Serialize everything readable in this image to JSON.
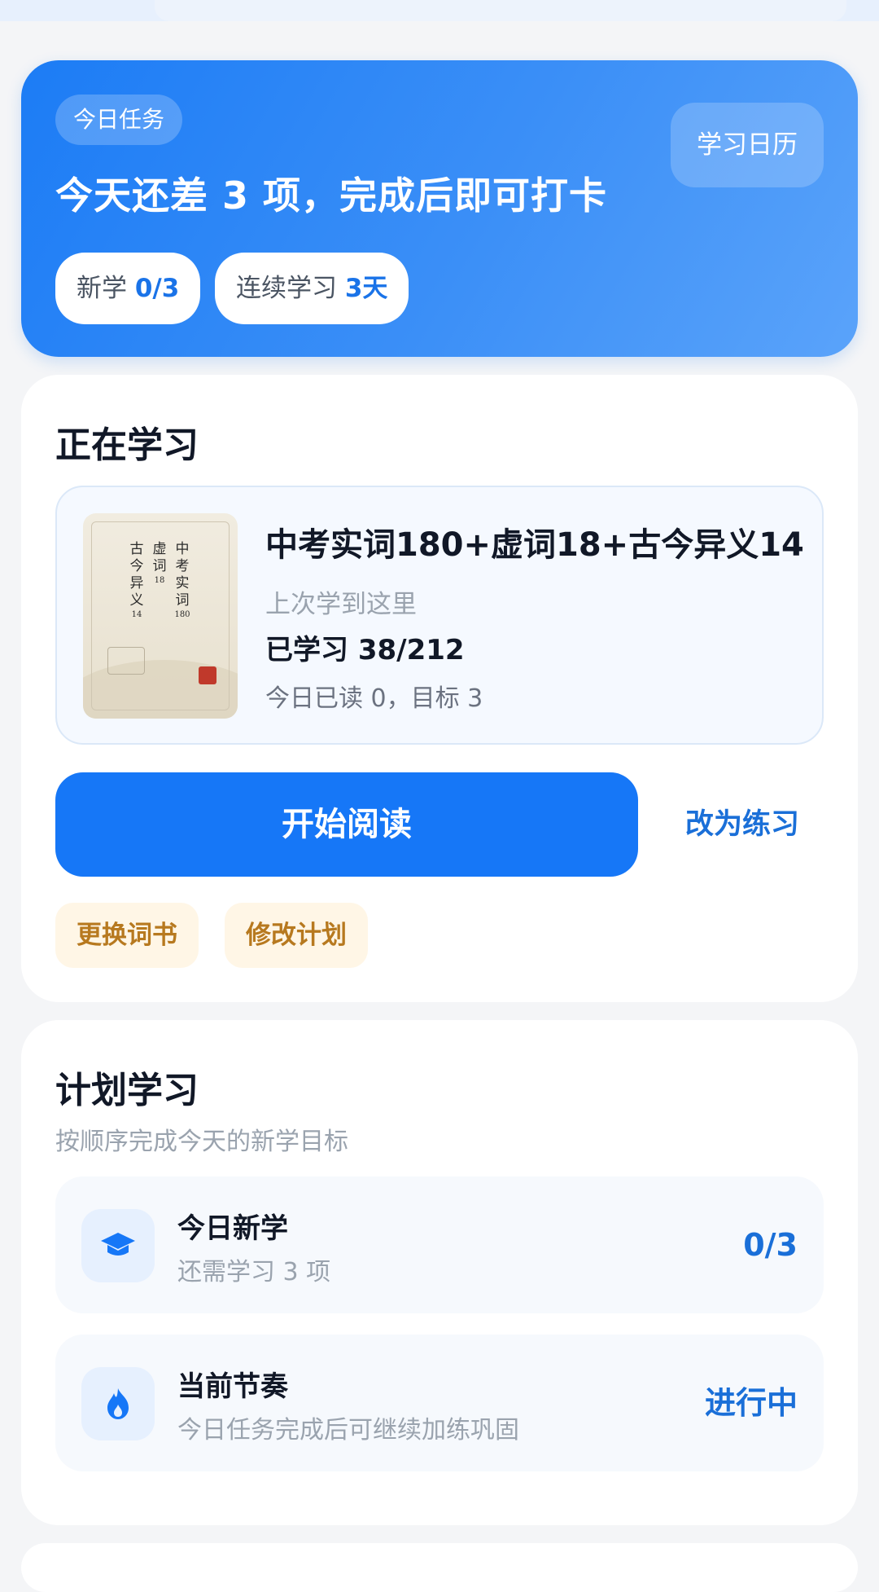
{
  "banner": {
    "chip": "今日任务",
    "title": "今天还差 3 项，完成后即可打卡",
    "calendar_button": "学习日历",
    "new_label": "新学",
    "new_value": "0/3",
    "streak_label": "连续学习",
    "streak_value": "3天"
  },
  "studying": {
    "title": "正在学习",
    "book": {
      "title": "中考实词180+虚词18+古今异义14",
      "last_position": "上次学到这里",
      "progress": "已学习 38/212",
      "today": "今日已读 0，目标 3",
      "cover_text": {
        "col1": "中考实词",
        "col1_num": "180",
        "col2": "虚词",
        "col2_num": "18",
        "col3": "古今异义",
        "col3_num": "14"
      }
    },
    "start_button": "开始阅读",
    "practice_link": "改为练习",
    "change_book": "更换词书",
    "modify_plan": "修改计划"
  },
  "plan": {
    "title": "计划学习",
    "subtitle": "按顺序完成今天的新学目标",
    "items": [
      {
        "name": "今日新学",
        "desc": "还需学习 3 项",
        "value": "0/3",
        "icon": "graduation-cap-icon"
      },
      {
        "name": "当前节奏",
        "desc": "今日任务完成后可继续加练巩固",
        "value": "进行中",
        "icon": "flame-icon"
      }
    ]
  },
  "colors": {
    "primary": "#1677f7",
    "accent_text": "#1a6fd8",
    "warm_button_bg": "#fff6e6",
    "warm_button_text": "#b7791f"
  }
}
